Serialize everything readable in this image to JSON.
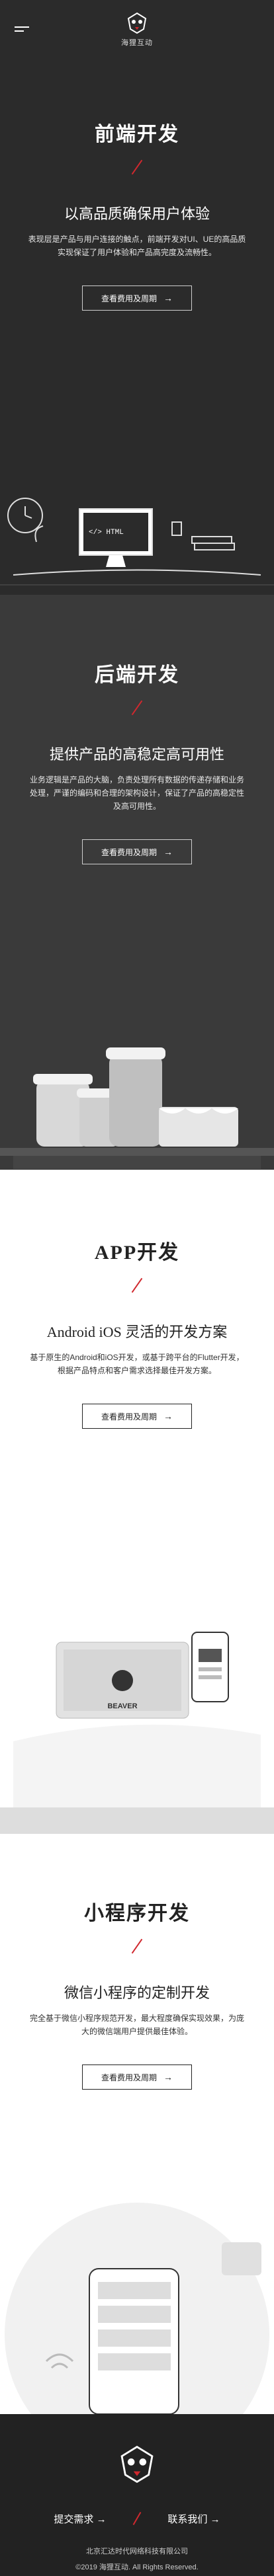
{
  "header": {
    "logo_text": "海狸互动"
  },
  "sections": [
    {
      "title": "前端开发",
      "subtitle": "以高品质确保用户体验",
      "desc": "表现层是产品与用户连接的触点，前端开发对UI、UE的高品质实现保证了用户体验和产品高完度及流畅性。",
      "cta": "查看费用及周期",
      "code_label": "</> HTML"
    },
    {
      "title": "后端开发",
      "subtitle": "提供产品的高稳定高可用性",
      "desc": "业务逻辑是产品的大脑，负责处理所有数据的传递存储和业务处理，严谨的编码和合理的架构设计，保证了产品的高稳定性及高可用性。",
      "cta": "查看费用及周期"
    },
    {
      "title": "APP开发",
      "subtitle": "Android iOS 灵活的开发方案",
      "desc": "基于原生的Android和iOS开发，或基于跨平台的Flutter开发，根据产品特点和客户需求选择最佳开发方案。",
      "cta": "查看费用及周期",
      "brand": "BEAVER"
    },
    {
      "title": "小程序开发",
      "subtitle": "微信小程序的定制开发",
      "desc": "完全基于微信小程序规范开发，最大程度确保实现效果，为庞大的微信端用户提供最佳体验。",
      "cta": "查看费用及周期"
    }
  ],
  "footer": {
    "links": [
      "提交需求 →",
      "联系我们 →"
    ],
    "company": "北京汇达时代网络科技有限公司",
    "copyright": "©2019 海狸互动. All Rights Reserved."
  },
  "colors": {
    "accent": "#d0282e",
    "dark": "#2b2b2b",
    "mid": "#3a3a3a",
    "footer": "#222222"
  }
}
